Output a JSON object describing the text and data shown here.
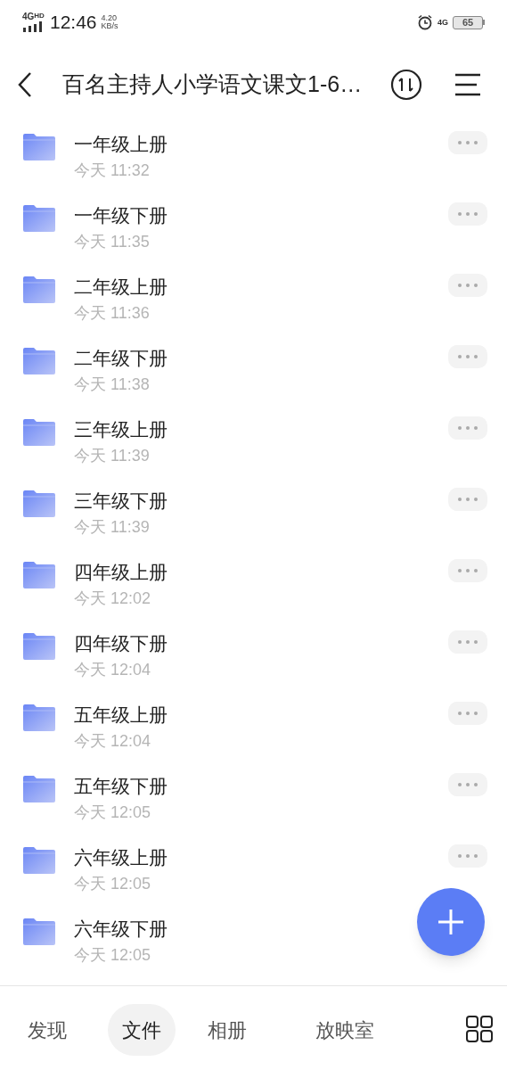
{
  "status_bar": {
    "network": "4G",
    "network_sup": "HD",
    "time": "12:46",
    "speed": "4.20",
    "speed_unit": "KB/s",
    "data_type": "4G",
    "battery": "65"
  },
  "header": {
    "title": "百名主持人小学语文课文1-6…"
  },
  "folders": [
    {
      "name": "一年级上册",
      "time": "今天 11:32",
      "more_visible": true
    },
    {
      "name": "一年级下册",
      "time": "今天 11:35",
      "more_visible": true
    },
    {
      "name": "二年级上册",
      "time": "今天 11:36",
      "more_visible": true
    },
    {
      "name": "二年级下册",
      "time": "今天 11:38",
      "more_visible": true
    },
    {
      "name": "三年级上册",
      "time": "今天 11:39",
      "more_visible": true
    },
    {
      "name": "三年级下册",
      "time": "今天 11:39",
      "more_visible": true
    },
    {
      "name": "四年级上册",
      "time": "今天 12:02",
      "more_visible": true
    },
    {
      "name": "四年级下册",
      "time": "今天 12:04",
      "more_visible": true
    },
    {
      "name": "五年级上册",
      "time": "今天 12:04",
      "more_visible": true
    },
    {
      "name": "五年级下册",
      "time": "今天 12:05",
      "more_visible": true
    },
    {
      "name": "六年级上册",
      "time": "今天 12:05",
      "more_visible": true
    },
    {
      "name": "六年级下册",
      "time": "今天 12:05",
      "more_visible": false
    }
  ],
  "bottom_nav": [
    {
      "label": "发现",
      "selected": false
    },
    {
      "label": "文件",
      "selected": true
    },
    {
      "label": "相册",
      "selected": false
    },
    {
      "label": "放映室",
      "selected": false
    }
  ]
}
